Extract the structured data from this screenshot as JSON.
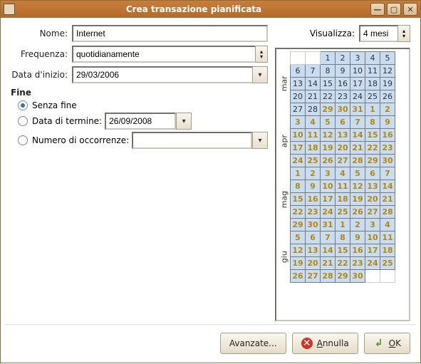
{
  "window": {
    "title": "Crea transazione pianificata"
  },
  "labels": {
    "name": "Nome:",
    "frequency": "Frequenza:",
    "startDate": "Data d'inizio:",
    "endGroup": "Fine",
    "noEnd": "Senza fine",
    "endDate": "Data di termine:",
    "occurrences": "Numero di occorrenze:",
    "view": "Visualizza:"
  },
  "values": {
    "name": "Internet",
    "frequency": "quotidianamente",
    "startDate": "29/03/2006",
    "endDate": "26/09/2008",
    "occurrences": "",
    "viewMonths": "4 mesi"
  },
  "radios": {
    "selected": "noEnd"
  },
  "months": [
    "mar",
    "apr",
    "mag",
    "giu"
  ],
  "calRows": [
    {
      "m": 0,
      "cells": [
        {
          "v": "",
          "e": true
        },
        {
          "v": "",
          "e": true
        },
        {
          "v": "1"
        },
        {
          "v": "2"
        },
        {
          "v": "3"
        },
        {
          "v": "4"
        },
        {
          "v": "5"
        }
      ]
    },
    {
      "m": 0,
      "cells": [
        {
          "v": "6"
        },
        {
          "v": "7"
        },
        {
          "v": "8"
        },
        {
          "v": "9"
        },
        {
          "v": "10"
        },
        {
          "v": "11"
        },
        {
          "v": "12"
        }
      ]
    },
    {
      "m": 0,
      "cells": [
        {
          "v": "13"
        },
        {
          "v": "14"
        },
        {
          "v": "15"
        },
        {
          "v": "16"
        },
        {
          "v": "17"
        },
        {
          "v": "18"
        },
        {
          "v": "19"
        }
      ]
    },
    {
      "m": 0,
      "cells": [
        {
          "v": "20"
        },
        {
          "v": "21"
        },
        {
          "v": "22"
        },
        {
          "v": "23"
        },
        {
          "v": "24"
        },
        {
          "v": "25"
        },
        {
          "v": "26"
        }
      ]
    },
    {
      "m": 0,
      "cells": [
        {
          "v": "27"
        },
        {
          "v": "28"
        },
        {
          "v": "29",
          "h": true
        },
        {
          "v": "30",
          "h": true
        },
        {
          "v": "31",
          "h": true
        },
        {
          "v": "1",
          "h": true
        },
        {
          "v": "2",
          "h": true
        }
      ]
    },
    {
      "m": 1,
      "cells": [
        {
          "v": "3",
          "h": true
        },
        {
          "v": "4",
          "h": true
        },
        {
          "v": "5",
          "h": true
        },
        {
          "v": "6",
          "h": true
        },
        {
          "v": "7",
          "h": true
        },
        {
          "v": "8",
          "h": true
        },
        {
          "v": "9",
          "h": true
        }
      ]
    },
    {
      "m": 1,
      "cells": [
        {
          "v": "10",
          "h": true
        },
        {
          "v": "11",
          "h": true
        },
        {
          "v": "12",
          "h": true
        },
        {
          "v": "13",
          "h": true
        },
        {
          "v": "14",
          "h": true
        },
        {
          "v": "15",
          "h": true
        },
        {
          "v": "16",
          "h": true
        }
      ]
    },
    {
      "m": 1,
      "cells": [
        {
          "v": "17",
          "h": true
        },
        {
          "v": "18",
          "h": true
        },
        {
          "v": "19",
          "h": true
        },
        {
          "v": "20",
          "h": true
        },
        {
          "v": "21",
          "h": true
        },
        {
          "v": "22",
          "h": true
        },
        {
          "v": "23",
          "h": true
        }
      ]
    },
    {
      "m": 1,
      "cells": [
        {
          "v": "24",
          "h": true
        },
        {
          "v": "25",
          "h": true
        },
        {
          "v": "26",
          "h": true
        },
        {
          "v": "27",
          "h": true
        },
        {
          "v": "28",
          "h": true
        },
        {
          "v": "29",
          "h": true
        },
        {
          "v": "30",
          "h": true
        }
      ]
    },
    {
      "m": 2,
      "cells": [
        {
          "v": "1",
          "h": true
        },
        {
          "v": "2",
          "h": true
        },
        {
          "v": "3",
          "h": true
        },
        {
          "v": "4",
          "h": true
        },
        {
          "v": "5",
          "h": true
        },
        {
          "v": "6",
          "h": true
        },
        {
          "v": "7",
          "h": true
        }
      ]
    },
    {
      "m": 2,
      "cells": [
        {
          "v": "8",
          "h": true
        },
        {
          "v": "9",
          "h": true
        },
        {
          "v": "10",
          "h": true
        },
        {
          "v": "11",
          "h": true
        },
        {
          "v": "12",
          "h": true
        },
        {
          "v": "13",
          "h": true
        },
        {
          "v": "14",
          "h": true
        }
      ]
    },
    {
      "m": 2,
      "cells": [
        {
          "v": "15",
          "h": true
        },
        {
          "v": "16",
          "h": true
        },
        {
          "v": "17",
          "h": true
        },
        {
          "v": "18",
          "h": true
        },
        {
          "v": "19",
          "h": true
        },
        {
          "v": "20",
          "h": true
        },
        {
          "v": "21",
          "h": true
        }
      ]
    },
    {
      "m": 2,
      "cells": [
        {
          "v": "22",
          "h": true
        },
        {
          "v": "23",
          "h": true
        },
        {
          "v": "24",
          "h": true
        },
        {
          "v": "25",
          "h": true
        },
        {
          "v": "26",
          "h": true
        },
        {
          "v": "27",
          "h": true
        },
        {
          "v": "28",
          "h": true
        }
      ]
    },
    {
      "m": 2,
      "cells": [
        {
          "v": "29",
          "h": true
        },
        {
          "v": "30",
          "h": true
        },
        {
          "v": "31",
          "h": true
        },
        {
          "v": "1",
          "h": true
        },
        {
          "v": "2",
          "h": true
        },
        {
          "v": "3",
          "h": true
        },
        {
          "v": "4",
          "h": true
        }
      ]
    },
    {
      "m": 3,
      "cells": [
        {
          "v": "5",
          "h": true
        },
        {
          "v": "6",
          "h": true
        },
        {
          "v": "7",
          "h": true
        },
        {
          "v": "8",
          "h": true
        },
        {
          "v": "9",
          "h": true
        },
        {
          "v": "10",
          "h": true
        },
        {
          "v": "11",
          "h": true
        }
      ]
    },
    {
      "m": 3,
      "cells": [
        {
          "v": "12",
          "h": true
        },
        {
          "v": "13",
          "h": true
        },
        {
          "v": "14",
          "h": true
        },
        {
          "v": "15",
          "h": true
        },
        {
          "v": "16",
          "h": true
        },
        {
          "v": "17",
          "h": true
        },
        {
          "v": "18",
          "h": true
        }
      ]
    },
    {
      "m": 3,
      "cells": [
        {
          "v": "19",
          "h": true
        },
        {
          "v": "20",
          "h": true
        },
        {
          "v": "21",
          "h": true
        },
        {
          "v": "22",
          "h": true
        },
        {
          "v": "23",
          "h": true
        },
        {
          "v": "24",
          "h": true
        },
        {
          "v": "25",
          "h": true
        }
      ]
    },
    {
      "m": 3,
      "cells": [
        {
          "v": "26",
          "h": true
        },
        {
          "v": "27",
          "h": true
        },
        {
          "v": "28",
          "h": true
        },
        {
          "v": "29",
          "h": true
        },
        {
          "v": "30",
          "h": true
        },
        {
          "v": "",
          "e": true
        },
        {
          "v": "",
          "e": true
        }
      ]
    }
  ],
  "buttons": {
    "advanced": "Avanzate...",
    "cancel": "Annulla",
    "ok": "OK",
    "cancelPrefix": "A",
    "cancelRest": "nnulla",
    "okPrefix": "O",
    "okRest": "K"
  }
}
